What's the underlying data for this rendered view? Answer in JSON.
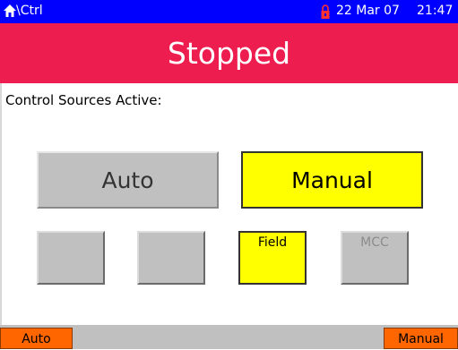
{
  "titlebar": {
    "icon": "home-icon",
    "path": "\\Ctrl",
    "lock_icon": "lock-icon",
    "date": "22 Mar 07",
    "time": "21:47"
  },
  "status": {
    "text": "Stopped"
  },
  "section": {
    "label": "Control Sources Active:"
  },
  "mode_buttons": {
    "auto_label": "Auto",
    "manual_label": "Manual",
    "active": "Manual"
  },
  "source_buttons": {
    "src1_label": "",
    "src2_label": "",
    "field_label": "Field",
    "mcc_label": "MCC"
  },
  "softkeys": {
    "left_label": "Auto",
    "right_label": "Manual"
  },
  "colors": {
    "titlebar": "#0000ff",
    "status_banner": "#ee1d4f",
    "active_button": "#ffff00",
    "inactive_button": "#c0c0c0",
    "softkey": "#ff6600"
  }
}
